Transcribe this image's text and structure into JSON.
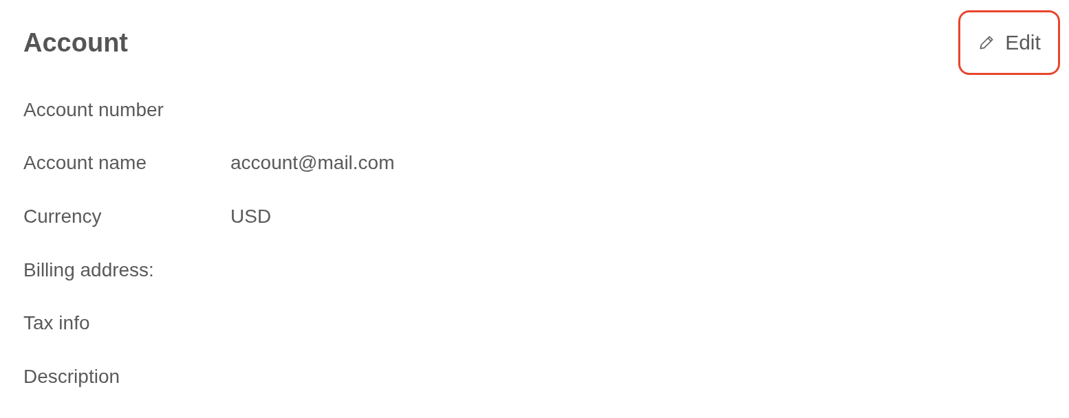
{
  "title": "Account",
  "edit_button": {
    "label": "Edit",
    "highlighted": true
  },
  "fields": [
    {
      "label": "Account number"
    },
    {
      "label": "Account name",
      "value": "account@mail.com"
    },
    {
      "label": "Currency",
      "value": "USD"
    },
    {
      "label": "Billing address:"
    },
    {
      "label": "Tax info"
    },
    {
      "label": "Description"
    }
  ]
}
